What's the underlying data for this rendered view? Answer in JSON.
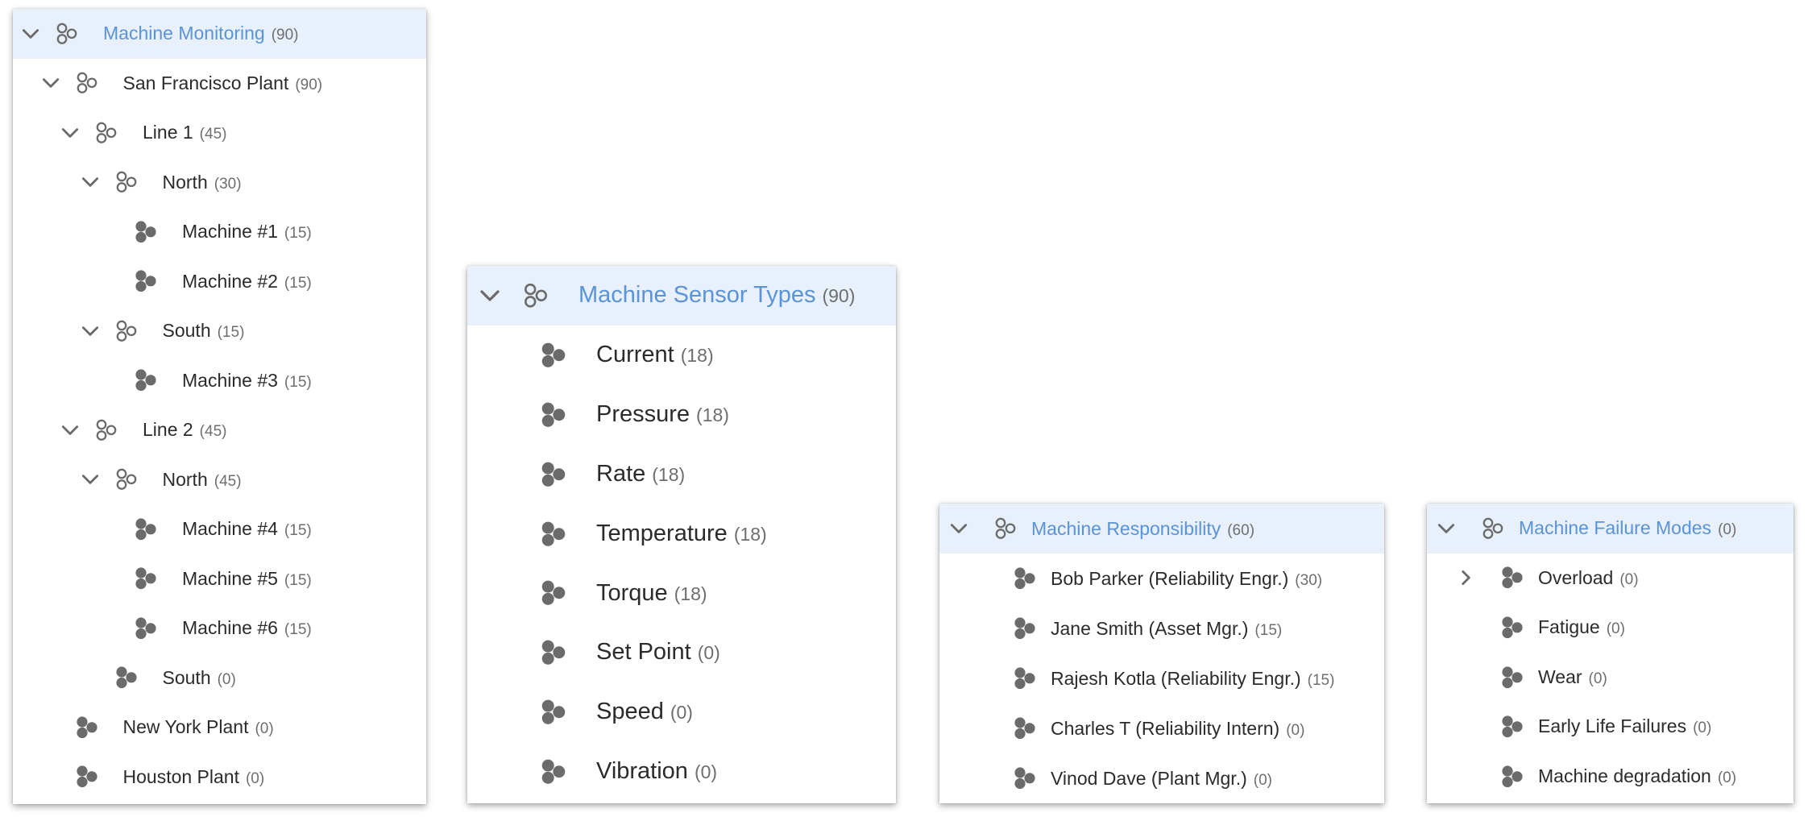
{
  "colors": {
    "accent": "#5a93d8",
    "header_bg": "#e8f0fb",
    "icon": "#6b6b6b",
    "count": "#6e6e6e"
  },
  "panels": [
    {
      "items": [
        {
          "label": "Machine Monitoring",
          "count": "(90)",
          "chevron": "down",
          "icon": "hierarchy-outline-icon",
          "header": true
        },
        {
          "label": "San Francisco Plant",
          "count": "(90)",
          "chevron": "down",
          "icon": "hierarchy-outline-icon"
        },
        {
          "label": "Line 1",
          "count": "(45)",
          "chevron": "down",
          "icon": "hierarchy-outline-icon"
        },
        {
          "label": "North",
          "count": "(30)",
          "chevron": "down",
          "icon": "hierarchy-outline-icon"
        },
        {
          "label": "Machine #1",
          "count": "(15)",
          "chevron": "",
          "icon": "hierarchy-filled-icon"
        },
        {
          "label": "Machine #2",
          "count": "(15)",
          "chevron": "",
          "icon": "hierarchy-filled-icon"
        },
        {
          "label": "South",
          "count": "(15)",
          "chevron": "down",
          "icon": "hierarchy-outline-icon"
        },
        {
          "label": "Machine #3",
          "count": "(15)",
          "chevron": "",
          "icon": "hierarchy-filled-icon"
        },
        {
          "label": "Line 2",
          "count": "(45)",
          "chevron": "down",
          "icon": "hierarchy-outline-icon"
        },
        {
          "label": "North",
          "count": "(45)",
          "chevron": "down",
          "icon": "hierarchy-outline-icon"
        },
        {
          "label": "Machine #4",
          "count": "(15)",
          "chevron": "",
          "icon": "hierarchy-filled-icon"
        },
        {
          "label": "Machine #5",
          "count": "(15)",
          "chevron": "",
          "icon": "hierarchy-filled-icon"
        },
        {
          "label": "Machine #6",
          "count": "(15)",
          "chevron": "",
          "icon": "hierarchy-filled-icon"
        },
        {
          "label": "South",
          "count": "(0)",
          "chevron": "",
          "icon": "hierarchy-filled-icon"
        },
        {
          "label": "New York Plant",
          "count": "(0)",
          "chevron": "",
          "icon": "hierarchy-filled-icon"
        },
        {
          "label": "Houston Plant",
          "count": "(0)",
          "chevron": "",
          "icon": "hierarchy-filled-icon"
        }
      ]
    },
    {
      "items": [
        {
          "label": "Machine Sensor Types",
          "count": "(90)",
          "chevron": "down",
          "icon": "hierarchy-outline-icon",
          "header": true
        },
        {
          "label": "Current",
          "count": "(18)",
          "chevron": "",
          "icon": "hierarchy-filled-icon"
        },
        {
          "label": "Pressure",
          "count": "(18)",
          "chevron": "",
          "icon": "hierarchy-filled-icon"
        },
        {
          "label": "Rate",
          "count": "(18)",
          "chevron": "",
          "icon": "hierarchy-filled-icon"
        },
        {
          "label": "Temperature",
          "count": "(18)",
          "chevron": "",
          "icon": "hierarchy-filled-icon"
        },
        {
          "label": "Torque",
          "count": "(18)",
          "chevron": "",
          "icon": "hierarchy-filled-icon"
        },
        {
          "label": "Set Point",
          "count": "(0)",
          "chevron": "",
          "icon": "hierarchy-filled-icon"
        },
        {
          "label": "Speed",
          "count": "(0)",
          "chevron": "",
          "icon": "hierarchy-filled-icon"
        },
        {
          "label": "Vibration",
          "count": "(0)",
          "chevron": "",
          "icon": "hierarchy-filled-icon"
        }
      ]
    },
    {
      "items": [
        {
          "label": "Machine Responsibility",
          "count": "(60)",
          "chevron": "down",
          "icon": "hierarchy-outline-icon",
          "header": true
        },
        {
          "label": "Bob Parker (Reliability Engr.)",
          "count": "(30)",
          "chevron": "",
          "icon": "hierarchy-filled-icon"
        },
        {
          "label": "Jane Smith (Asset Mgr.)",
          "count": "(15)",
          "chevron": "",
          "icon": "hierarchy-filled-icon"
        },
        {
          "label": "Rajesh Kotla (Reliability Engr.)",
          "count": "(15)",
          "chevron": "",
          "icon": "hierarchy-filled-icon"
        },
        {
          "label": "Charles T (Reliability Intern)",
          "count": "(0)",
          "chevron": "",
          "icon": "hierarchy-filled-icon"
        },
        {
          "label": "Vinod Dave (Plant Mgr.)",
          "count": "(0)",
          "chevron": "",
          "icon": "hierarchy-filled-icon"
        }
      ]
    },
    {
      "items": [
        {
          "label": "Machine Failure Modes",
          "count": "(0)",
          "chevron": "down",
          "icon": "hierarchy-outline-icon",
          "header": true
        },
        {
          "label": "Overload",
          "count": "(0)",
          "chevron": "right",
          "icon": "hierarchy-filled-icon"
        },
        {
          "label": "Fatigue",
          "count": "(0)",
          "chevron": "",
          "icon": "hierarchy-filled-icon"
        },
        {
          "label": "Wear",
          "count": "(0)",
          "chevron": "",
          "icon": "hierarchy-filled-icon"
        },
        {
          "label": "Early Life Failures",
          "count": "(0)",
          "chevron": "",
          "icon": "hierarchy-filled-icon"
        },
        {
          "label": "Machine degradation",
          "count": "(0)",
          "chevron": "",
          "icon": "hierarchy-filled-icon"
        }
      ]
    }
  ]
}
